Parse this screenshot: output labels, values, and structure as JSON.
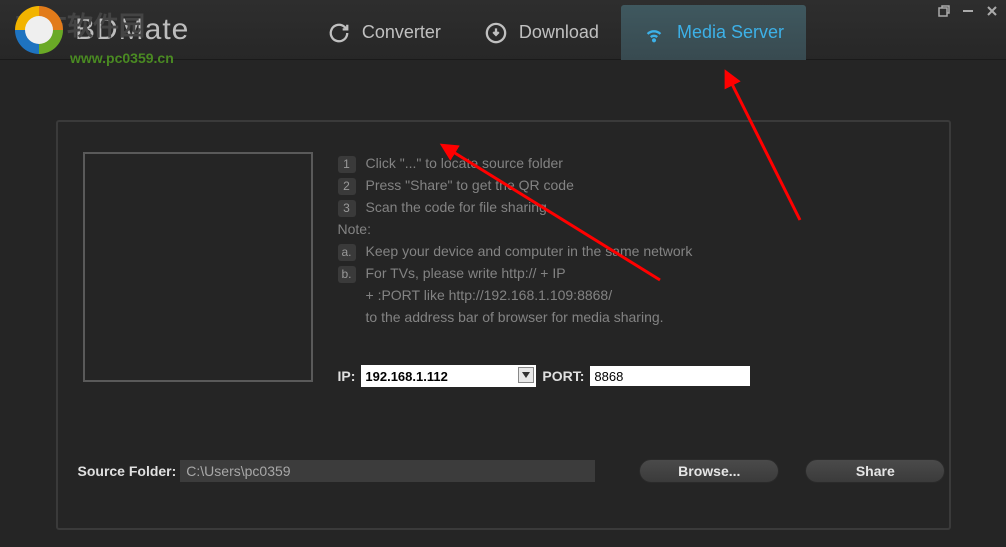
{
  "app": {
    "title": "BDMate",
    "watermark": "对方软件园",
    "watermark_url": "www.pc0359.cn"
  },
  "tabs": {
    "converter": "Converter",
    "download": "Download",
    "media_server": "Media Server"
  },
  "instructions": {
    "step1_badge": "1",
    "step1": "Click \"...\" to locate source folder",
    "step2_badge": "2",
    "step2": "Press \"Share\" to get the QR code",
    "step3_badge": "3",
    "step3": "Scan the code for file sharing",
    "note_label": "Note:",
    "note_a_badge": "a.",
    "note_a": "Keep your device and computer in the same network",
    "note_b_badge": "b.",
    "note_b1": "For TVs, please write http:// + IP",
    "note_b2": "+ :PORT like http://192.168.1.109:8868/",
    "note_b3": "to the address bar of browser for media sharing."
  },
  "network": {
    "ip_label": "IP:",
    "ip_value": "192.168.1.112",
    "port_label": "PORT:",
    "port_value": "8868"
  },
  "source": {
    "label": "Source Folder:",
    "value": "C:\\Users\\pc0359"
  },
  "buttons": {
    "browse": "Browse...",
    "share": "Share"
  }
}
